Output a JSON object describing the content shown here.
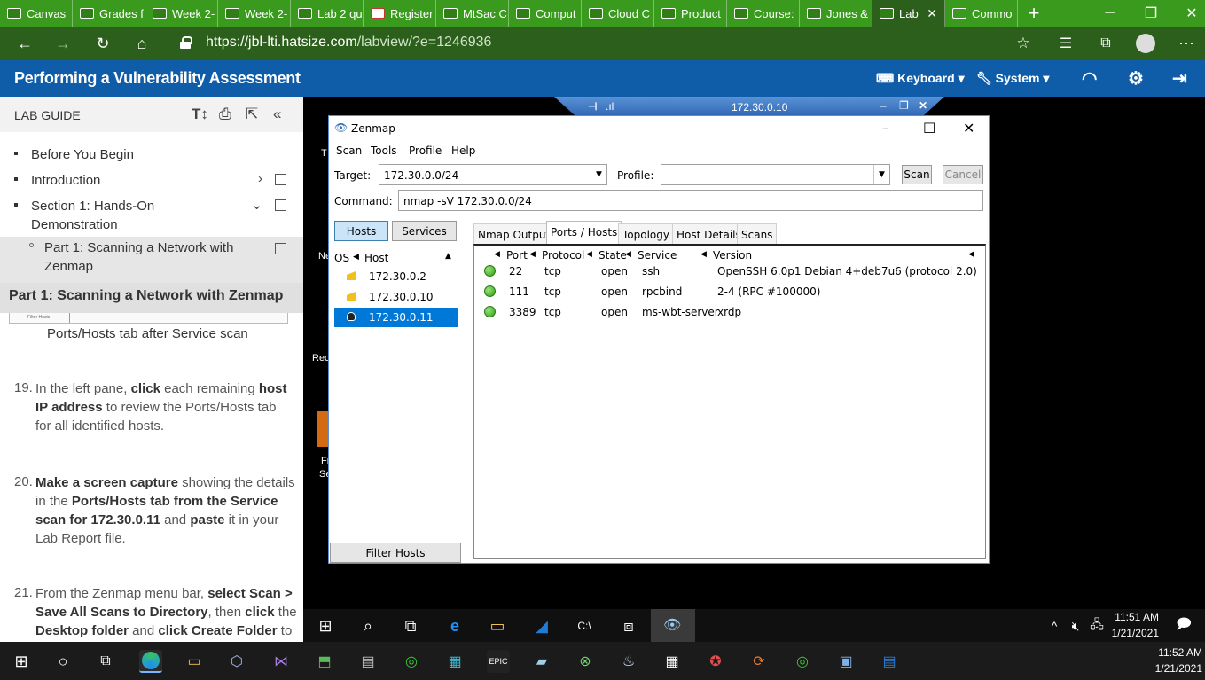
{
  "browser": {
    "tabs": [
      {
        "label": "Canvas"
      },
      {
        "label": "Grades f"
      },
      {
        "label": "Week 2-"
      },
      {
        "label": "Week 2-"
      },
      {
        "label": "Lab 2 qu"
      },
      {
        "label": "Register"
      },
      {
        "label": "MtSac C"
      },
      {
        "label": "Comput"
      },
      {
        "label": "Cloud C"
      },
      {
        "label": "Product"
      },
      {
        "label": "Course:"
      },
      {
        "label": "Jones &"
      },
      {
        "label": "Lab"
      },
      {
        "label": "Commo"
      }
    ],
    "url_host": "https://jbl-lti.hatsize.com",
    "url_path": "/labview/?e=1246936"
  },
  "app": {
    "title": "Performing a Vulnerability Assessment",
    "keyboard_label": "Keyboard",
    "system_label": "System"
  },
  "guide": {
    "header": "LAB GUIDE",
    "toc": [
      {
        "label": "Before You Begin"
      },
      {
        "label": "Introduction"
      },
      {
        "label": "Section 1: Hands-On",
        "label2": "Demonstration"
      },
      {
        "label": "Part 1: Scanning a Network with",
        "label2": "Zenmap"
      }
    ],
    "section_title": "Part 1: Scanning a Network with Zenmap",
    "thumb_caption": "Filter Hosts",
    "figure_caption": "Ports/Hosts tab after Service scan",
    "steps": [
      {
        "num": "19.",
        "l1a": "In the left pane, ",
        "l1b": "click",
        "l1c": " each remaining ",
        "l1d": "host",
        "l2a": "IP address",
        "l2b": " to review the Ports/Hosts tab",
        "l3": "for all identified hosts."
      },
      {
        "num": "20.",
        "l1a": "Make a screen capture",
        "l1b": " showing the details",
        "l2a": "in the ",
        "l2b": "Ports/Hosts tab from the Service",
        "l3a": "scan for 172.30.0.11",
        "l3b": " and ",
        "l3c": "paste",
        "l3d": " it in your",
        "l4": "Lab Report file."
      },
      {
        "num": "21.",
        "l1a": "From the Zenmap menu bar, ",
        "l1b": "select Scan >",
        "l2a": "Save All Scans to Directory",
        "l2b": ", then ",
        "l2c": "click",
        "l2d": " the",
        "l3a": "Desktop folder",
        "l3b": " and ",
        "l3c": "click Create Folder",
        "l3d": " to"
      }
    ]
  },
  "rdp": {
    "conn_host": "172.30.0.10",
    "desktop_labels": [
      "T",
      "Ne",
      "Rec",
      "Fi",
      "Se"
    ]
  },
  "zenmap": {
    "title": "Zenmap",
    "menu": [
      "Scan",
      "Tools",
      "Profile",
      "Help"
    ],
    "target_label": "Target:",
    "target_value": "172.30.0.0/24",
    "profile_label": "Profile:",
    "profile_value": "",
    "scan_btn": "Scan",
    "cancel_btn": "Cancel",
    "command_label": "Command:",
    "command_value": "nmap -sV 172.30.0.0/24",
    "hosts_btn": "Hosts",
    "services_btn": "Services",
    "host_col_os": "OS",
    "host_col_host": "Host",
    "hosts": [
      {
        "ip": "172.30.0.2",
        "selected": false
      },
      {
        "ip": "172.30.0.10",
        "selected": false
      },
      {
        "ip": "172.30.0.11",
        "selected": true
      }
    ],
    "filter_btn": "Filter Hosts",
    "tabs": [
      "Nmap Output",
      "Ports / Hosts",
      "Topology",
      "Host Details",
      "Scans"
    ],
    "active_tab": "Ports / Hosts",
    "port_headers": [
      "Port",
      "Protocol",
      "State",
      "Service",
      "Version"
    ],
    "ports": [
      {
        "port": "22",
        "protocol": "tcp",
        "state": "open",
        "service": "ssh",
        "version": "OpenSSH 6.0p1 Debian 4+deb7u6 (protocol 2.0)"
      },
      {
        "port": "111",
        "protocol": "tcp",
        "state": "open",
        "service": "rpcbind",
        "version": "2-4 (RPC #100000)"
      },
      {
        "port": "3389",
        "protocol": "tcp",
        "state": "open",
        "service": "ms-wbt-server",
        "version": "xrdp"
      }
    ]
  },
  "remote_clock": {
    "time": "11:51 AM",
    "date": "1/21/2021"
  },
  "host_clock": {
    "time": "11:52 AM",
    "date": "1/21/2021"
  }
}
